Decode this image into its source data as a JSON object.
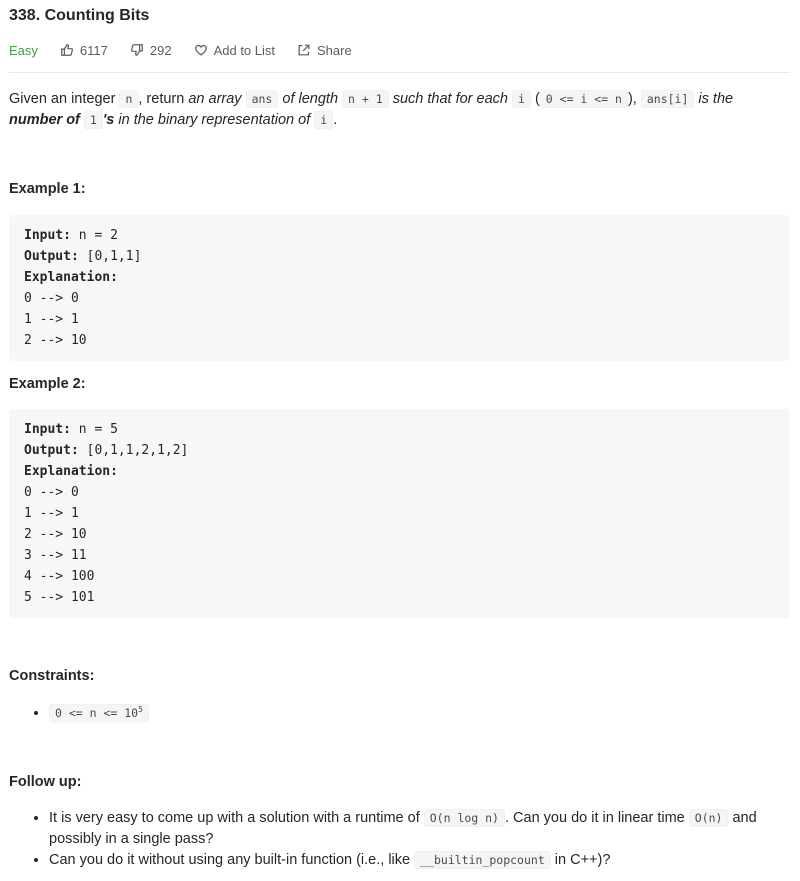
{
  "problem": {
    "title": "338. Counting Bits",
    "difficulty": "Easy",
    "likes": "6117",
    "dislikes": "292",
    "add_to_list_label": "Add to List",
    "share_label": "Share",
    "difficulty_color": "#43a047"
  },
  "description": {
    "t1": "Given an integer ",
    "c1": "n",
    "t2": ", return ",
    "e1": "an array ",
    "c2": "ans",
    "e2": " of length ",
    "c3": "n + 1",
    "e3": " such that for each ",
    "c4": "i",
    "t3": " (",
    "c5": "0 <= i <= n",
    "t4": "), ",
    "c6": "ans[i]",
    "e4": " is the ",
    "s1": "number of ",
    "c7": "1",
    "s2": "'s",
    "e5": " in the binary representation of ",
    "c8": "i",
    "t5": "."
  },
  "example1": {
    "heading": "Example 1:",
    "input_label": "Input:",
    "input_value": " n = 2",
    "output_label": "Output:",
    "output_value": " [0,1,1]",
    "explanation_label": "Explanation:",
    "lines": [
      "0 --> 0",
      "1 --> 1",
      "2 --> 10"
    ]
  },
  "example2": {
    "heading": "Example 2:",
    "input_label": "Input:",
    "input_value": " n = 5",
    "output_label": "Output:",
    "output_value": " [0,1,1,2,1,2]",
    "explanation_label": "Explanation:",
    "lines": [
      "0 --> 0",
      "1 --> 1",
      "2 --> 10",
      "3 --> 11",
      "4 --> 100",
      "5 --> 101"
    ]
  },
  "constraints": {
    "heading": "Constraints:",
    "c1_base": "0 <= n <= 10",
    "c1_exp": "5"
  },
  "followup": {
    "heading": "Follow up:",
    "i1_t1": "It is very easy to come up with a solution with a runtime of ",
    "i1_c1": "O(n log n)",
    "i1_t2": ". Can you do it in linear time ",
    "i1_c2": "O(n)",
    "i1_t3": " and possibly in a single pass?",
    "i2_t1": "Can you do it without using any built-in function (i.e., like ",
    "i2_c1": "__builtin_popcount",
    "i2_t2": " in C++)?"
  },
  "icons": {
    "like": "thumbs-up-icon",
    "dislike": "thumbs-down-icon",
    "add": "heart-icon",
    "share": "share-icon"
  }
}
